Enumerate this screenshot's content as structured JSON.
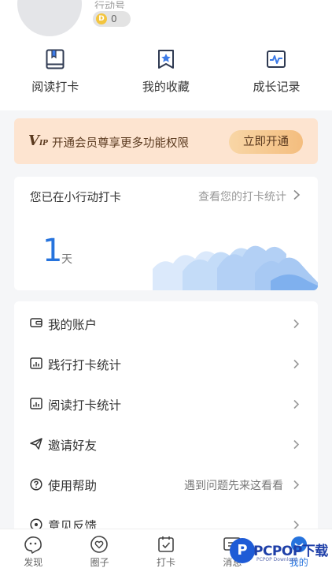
{
  "profile": {
    "nickname": "行动号",
    "coins": "0",
    "coin_symbol": "D"
  },
  "quick_actions": [
    {
      "label": "阅读打卡",
      "icon": "book-icon"
    },
    {
      "label": "我的收藏",
      "icon": "star-bookmark-icon"
    },
    {
      "label": "成长记录",
      "icon": "pulse-chart-icon"
    }
  ],
  "vip": {
    "logo": "V",
    "logo_small": "IP",
    "text": "开通会员尊享更多功能权限",
    "button": "立即开通"
  },
  "checkin": {
    "title": "您已在小行动打卡",
    "link": "查看您的打卡统计",
    "days": "1",
    "unit": "天"
  },
  "menu": [
    {
      "label": "我的账户",
      "icon": "wallet-icon",
      "hint": ""
    },
    {
      "label": "践行打卡统计",
      "icon": "stats-doc-icon",
      "hint": ""
    },
    {
      "label": "阅读打卡统计",
      "icon": "stats-doc-icon",
      "hint": ""
    },
    {
      "label": "邀请好友",
      "icon": "paper-plane-icon",
      "hint": ""
    },
    {
      "label": "使用帮助",
      "icon": "help-circle-icon",
      "hint": "遇到问题先来这看看"
    },
    {
      "label": "意见反馈",
      "icon": "feedback-icon",
      "hint": ""
    }
  ],
  "tabs": [
    {
      "label": "发现",
      "icon": "discover-icon",
      "active": false
    },
    {
      "label": "圈子",
      "icon": "circle-heart-icon",
      "active": false
    },
    {
      "label": "打卡",
      "icon": "calendar-check-icon",
      "active": false
    },
    {
      "label": "消息",
      "icon": "message-icon",
      "active": false
    },
    {
      "label": "我的",
      "icon": "profile-icon",
      "active": true
    }
  ],
  "watermark": {
    "brand": "PCPOP下载",
    "sub": "PCPOP Download"
  },
  "colors": {
    "accent": "#2673dd",
    "vip_bg": "#fde4d0",
    "vip_text": "#5b3a1f",
    "vip_button": "#f4bd7e"
  }
}
